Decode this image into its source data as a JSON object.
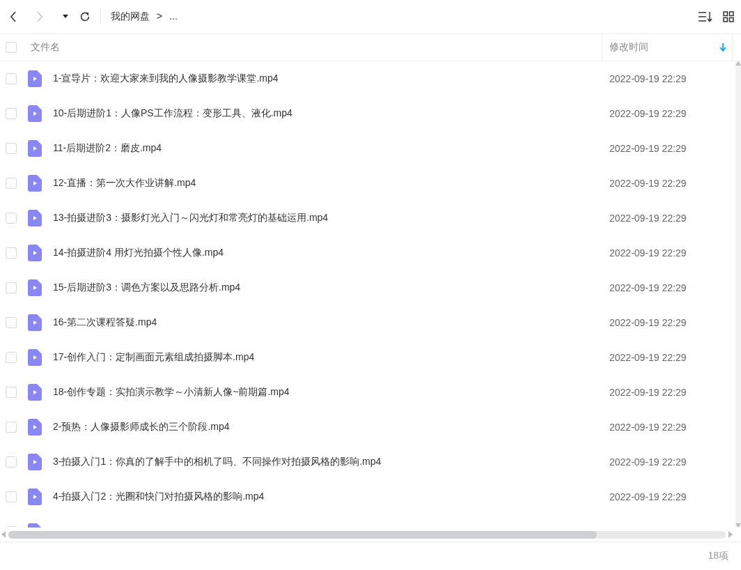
{
  "toolbar": {
    "breadcrumb": [
      {
        "label": "我的网盘"
      },
      {
        "label": ">"
      },
      {
        "label": "..."
      }
    ],
    "back_disabled": false,
    "forward_disabled": true
  },
  "table": {
    "header": {
      "checked": false,
      "columns": [
        {
          "label": "文件名",
          "sorted_descending": false
        },
        {
          "label": "修改时间",
          "sorted_descending": true
        }
      ]
    },
    "rows": [
      {
        "name": "1-宣导片：欢迎大家来到我的人像摄影教学课堂.mp4",
        "modified": "2022-09-19 22:29",
        "checked": false,
        "kind": "video"
      },
      {
        "name": "10-后期进阶1：人像PS工作流程：变形工具、液化.mp4",
        "modified": "2022-09-19 22:29",
        "checked": false,
        "kind": "video"
      },
      {
        "name": "11-后期进阶2：磨皮.mp4",
        "modified": "2022-09-19 22:29",
        "checked": false,
        "kind": "video"
      },
      {
        "name": "12-直播：第一次大作业讲解.mp4",
        "modified": "2022-09-19 22:29",
        "checked": false,
        "kind": "video"
      },
      {
        "name": "13-拍摄进阶3：摄影灯光入门～闪光灯和常亮灯的基础运用.mp4",
        "modified": "2022-09-19 22:29",
        "checked": false,
        "kind": "video"
      },
      {
        "name": "14-拍摄进阶4 用灯光拍摄个性人像.mp4",
        "modified": "2022-09-19 22:29",
        "checked": false,
        "kind": "video"
      },
      {
        "name": "15-后期进阶3：调色方案以及思路分析.mp4",
        "modified": "2022-09-19 22:29",
        "checked": false,
        "kind": "video"
      },
      {
        "name": "16-第二次课程答疑.mp4",
        "modified": "2022-09-19 22:29",
        "checked": false,
        "kind": "video"
      },
      {
        "name": "17-创作入门：定制画面元素组成拍摄脚本.mp4",
        "modified": "2022-09-19 22:29",
        "checked": false,
        "kind": "video"
      },
      {
        "name": "18-创作专题：实拍演示教学～小清新人像~前期篇.mp4",
        "modified": "2022-09-19 22:29",
        "checked": false,
        "kind": "video"
      },
      {
        "name": "2-预热：人像摄影师成长的三个阶段.mp4",
        "modified": "2022-09-19 22:29",
        "checked": false,
        "kind": "video"
      },
      {
        "name": "3-拍摄入门1：你真的了解手中的相机了吗、不同操作对拍摄风格的影响.mp4",
        "modified": "2022-09-19 22:29",
        "checked": false,
        "kind": "video"
      },
      {
        "name": "4-拍摄入门2：光圈和快门对拍摄风格的影响.mp4",
        "modified": "2022-09-19 22:29",
        "checked": false,
        "kind": "video"
      },
      {
        "checked": false,
        "kind": "video"
      }
    ]
  },
  "status_bar": {
    "count": "18项"
  }
}
